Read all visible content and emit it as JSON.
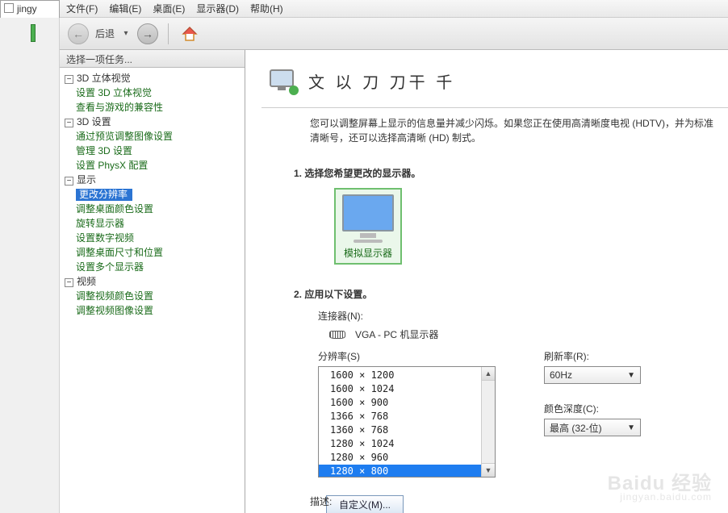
{
  "leftTabFragment": "jingy",
  "menubar": {
    "file": "文件(F)",
    "edit": "编辑(E)",
    "desktop": "桌面(E)",
    "display": "显示器(D)",
    "help": "帮助(H)"
  },
  "toolbar": {
    "back": "后退"
  },
  "sidebar": {
    "header": "选择一项任务...",
    "groups": [
      {
        "label": "3D 立体视觉",
        "items": [
          "设置 3D 立体视觉",
          "查看与游戏的兼容性"
        ]
      },
      {
        "label": "3D 设置",
        "items": [
          "通过预览调整图像设置",
          "管理 3D 设置",
          "设置 PhysX 配置"
        ]
      },
      {
        "label": "显示",
        "items": [
          "更改分辨率",
          "调整桌面颜色设置",
          "旋转显示器",
          "设置数字视频",
          "调整桌面尺寸和位置",
          "设置多个显示器"
        ],
        "selectedIndex": 0
      },
      {
        "label": "视频",
        "items": [
          "调整视频颜色设置",
          "调整视频图像设置"
        ]
      }
    ]
  },
  "page": {
    "titleFragment": "文 以 刀 刀干 千",
    "description": "您可以调整屏幕上显示的信息量并减少闪烁。如果您正在使用高清晰度电视 (HDTV)，并为标准清晰号，还可以选择高清晰 (HD) 制式。",
    "step1Title": "1.  选择您希望更改的显示器。",
    "monitorCaption": "模拟显示器",
    "step2Title": "2.  应用以下设置。",
    "connectorLabel": "连接器(N):",
    "connectorValue": "VGA - PC 机显示器",
    "resolutionLabel": "分辨率(S)",
    "resolutions": [
      "1600 × 1200",
      "1600 × 1024",
      "1600 × 900",
      "1366 × 768",
      "1360 × 768",
      "1280 × 1024",
      "1280 × 960",
      "1280 × 800"
    ],
    "resolutionSelected": "1280 × 800",
    "refreshLabel": "刷新率(R):",
    "refreshValue": "60Hz",
    "colorDepthLabel": "颜色深度(C):",
    "colorDepthValue": "最高 (32-位)",
    "customizeBtn": "自定义(M)...",
    "descLabel": "描述:"
  },
  "watermark": {
    "brand": "Baidu 经验",
    "url": "jingyan.baidu.com"
  }
}
